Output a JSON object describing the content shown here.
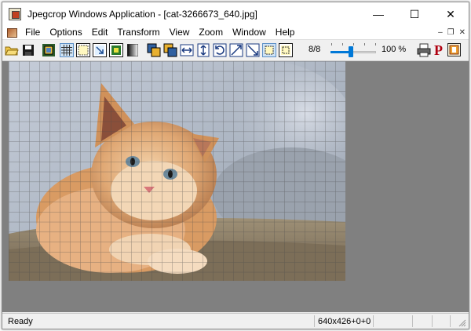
{
  "window": {
    "title": "Jpegcrop Windows Application - [cat-3266673_640.jpg]",
    "controls": {
      "minimize": "—",
      "maximize": "☐",
      "close": "✕"
    }
  },
  "menubar": {
    "items": [
      "File",
      "Options",
      "Edit",
      "Transform",
      "View",
      "Zoom",
      "Window",
      "Help"
    ],
    "mdi_controls": {
      "minimize": "–",
      "restore": "❐",
      "close": "✕"
    }
  },
  "toolbar": {
    "buttons": [
      "open-folder-icon",
      "save-disk-icon",
      "crop-select-icon",
      "grid-icon",
      "snap-grid-icon",
      "arrow-select-icon",
      "crop-frame-icon",
      "gradient-icon",
      "copy-image-icon",
      "paste-image-icon",
      "flip-horizontal-icon",
      "flip-vertical-icon",
      "rotate-icon",
      "transpose-icon",
      "transverse-icon",
      "select-all-icon",
      "crop-marquee-icon",
      "printer-icon",
      "p-logo-icon",
      "about-icon"
    ],
    "frame_count": "8/8",
    "zoom_level": "100 %",
    "zoom_slider_fraction": 0.45
  },
  "image": {
    "file_name": "cat-3266673_640.jpg",
    "description": "orange kitten on sofa with grid overlay"
  },
  "statusbar": {
    "left": "Ready",
    "right": "640x426+0+0"
  },
  "colors": {
    "accent": "#0078d7",
    "workspace": "#808080",
    "p_logo": "#b00010"
  }
}
